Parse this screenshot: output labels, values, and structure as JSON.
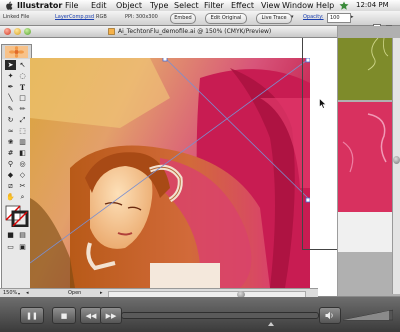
{
  "menubar": {
    "app": "Illustrator",
    "items": [
      "File",
      "Edit",
      "Object",
      "Type",
      "Select",
      "Filter",
      "Effect",
      "View",
      "Window",
      "Help"
    ],
    "clock": "12:04 PM"
  },
  "control_bar": {
    "linked_file_label": "Linked File",
    "file_link": "LayerComp.psd",
    "color_mode": "RGB",
    "ppi": "PPI: 300x300",
    "embed_label": "Embed",
    "edit_original_label": "Edit Original",
    "live_trace_label": "Live Trace",
    "opacity_label": "Opacity:",
    "opacity_value": "100"
  },
  "document": {
    "title": "Ai_TechtonFlu_demofile.ai @ 150% (CMYK/Preview)",
    "zoom": "150%",
    "status_text": "Open"
  },
  "player": {
    "progress": 0.0
  },
  "colors": {
    "accent_pink": "#d8316a",
    "panel_green": "#7a8a2a"
  }
}
